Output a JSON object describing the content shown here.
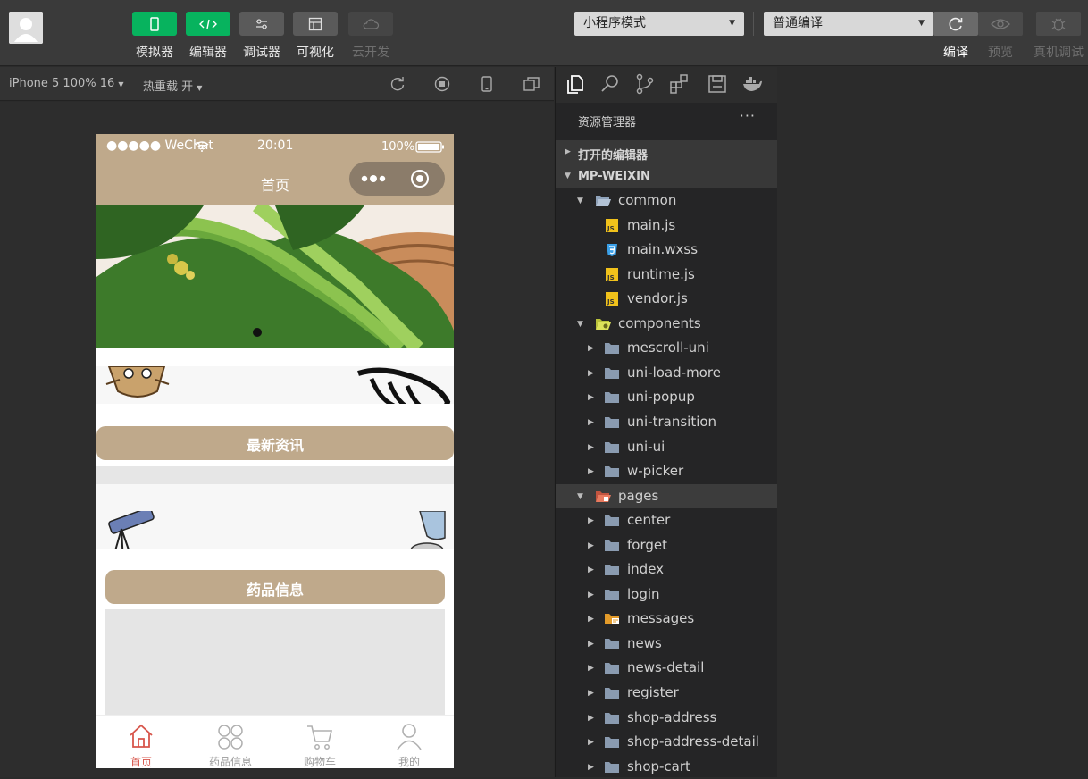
{
  "toolbar": {
    "buttons": [
      {
        "label": "模拟器",
        "icon": "phone-icon"
      },
      {
        "label": "编辑器",
        "icon": "code-icon"
      },
      {
        "label": "调试器",
        "icon": "sliders-icon"
      },
      {
        "label": "可视化",
        "icon": "layout-icon"
      },
      {
        "label": "云开发",
        "icon": "cloud-icon"
      }
    ],
    "mode_select": "小程序模式",
    "compile_select": "普通编译",
    "right_buttons": [
      {
        "label": "编译",
        "icon": "refresh-icon"
      },
      {
        "label": "预览",
        "icon": "eye-icon"
      },
      {
        "label": "真机调试",
        "icon": "bug-icon"
      }
    ]
  },
  "subbar": {
    "device": "iPhone 5 100% 16",
    "hot_reload": "热重载 开"
  },
  "phone": {
    "status_signal": "●●●●● WeChat",
    "status_time": "20:01",
    "status_battery": "100%",
    "nav_title": "首页",
    "section1": "最新资讯",
    "section2": "药品信息",
    "tabs": [
      {
        "label": "首页",
        "icon": "home-icon",
        "active": true
      },
      {
        "label": "药品信息",
        "icon": "grid-icon",
        "active": false
      },
      {
        "label": "购物车",
        "icon": "cart-icon",
        "active": false
      },
      {
        "label": "我的",
        "icon": "user-icon",
        "active": false
      }
    ]
  },
  "explorer": {
    "title": "资源管理器",
    "more": "···",
    "open_editors": "打开的编辑器",
    "project": "MP-WEIXIN",
    "tree": [
      {
        "name": "common",
        "type": "folder-open",
        "depth": 1
      },
      {
        "name": "main.js",
        "type": "js",
        "depth": 2
      },
      {
        "name": "main.wxss",
        "type": "css",
        "depth": 2
      },
      {
        "name": "runtime.js",
        "type": "js",
        "depth": 2
      },
      {
        "name": "vendor.js",
        "type": "js",
        "depth": 2
      },
      {
        "name": "components",
        "type": "folder-open-special",
        "depth": 1
      },
      {
        "name": "mescroll-uni",
        "type": "folder",
        "depth": 2
      },
      {
        "name": "uni-load-more",
        "type": "folder",
        "depth": 2
      },
      {
        "name": "uni-popup",
        "type": "folder",
        "depth": 2
      },
      {
        "name": "uni-transition",
        "type": "folder",
        "depth": 2
      },
      {
        "name": "uni-ui",
        "type": "folder",
        "depth": 2
      },
      {
        "name": "w-picker",
        "type": "folder",
        "depth": 2
      },
      {
        "name": "pages",
        "type": "folder-open-pages",
        "depth": 1
      },
      {
        "name": "center",
        "type": "folder",
        "depth": 2
      },
      {
        "name": "forget",
        "type": "folder",
        "depth": 2
      },
      {
        "name": "index",
        "type": "folder",
        "depth": 2
      },
      {
        "name": "login",
        "type": "folder",
        "depth": 2
      },
      {
        "name": "messages",
        "type": "folder-msg",
        "depth": 2
      },
      {
        "name": "news",
        "type": "folder",
        "depth": 2
      },
      {
        "name": "news-detail",
        "type": "folder",
        "depth": 2
      },
      {
        "name": "register",
        "type": "folder",
        "depth": 2
      },
      {
        "name": "shop-address",
        "type": "folder",
        "depth": 2
      },
      {
        "name": "shop-address-detail",
        "type": "folder",
        "depth": 2
      },
      {
        "name": "shop-cart",
        "type": "folder",
        "depth": 2
      }
    ]
  }
}
